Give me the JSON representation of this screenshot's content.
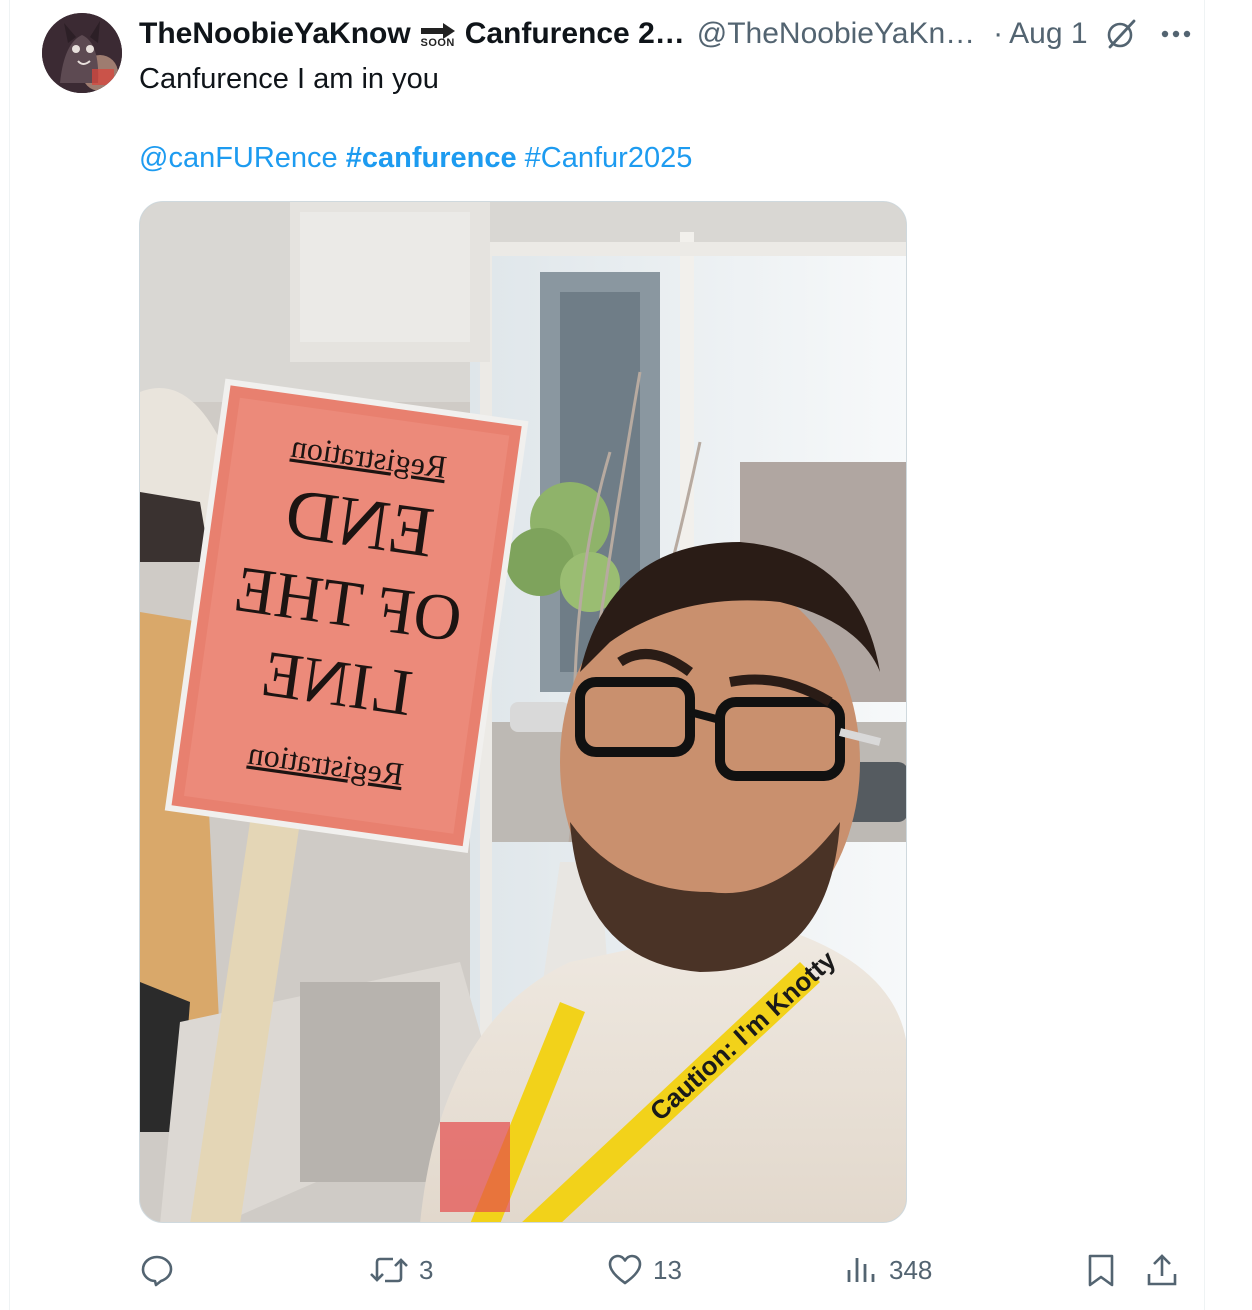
{
  "tweet": {
    "author_name": "TheNoobieYaKnow",
    "soon_label": "SOON",
    "display_suffix": "Canfurence 2…",
    "handle": "@TheNoobieYaKn…",
    "separator": "·",
    "date": "Aug 1",
    "text": "Canfurence I am in you",
    "mention": "@canFURence",
    "hashtag_1": "#canfurence",
    "hashtag_2": "#Canfur2025",
    "photo": {
      "sign_lines": [
        "Registration",
        "END",
        "OF THE",
        "LINE",
        "Registration"
      ],
      "lanyard_text": "Caution: I'm Knotty"
    },
    "actions": {
      "replies": "",
      "retweets": "3",
      "likes": "13",
      "views": "348"
    },
    "colors": {
      "link": "#1d9bf0",
      "muted": "#536471",
      "sign": "#ec8a7a",
      "lanyard": "#f2d21a"
    },
    "icons": {
      "grok": "grok-icon",
      "more": "more-icon",
      "reply": "reply-icon",
      "retweet": "retweet-icon",
      "like": "heart-icon",
      "views": "views-icon",
      "bookmark": "bookmark-icon",
      "share": "share-icon"
    }
  }
}
